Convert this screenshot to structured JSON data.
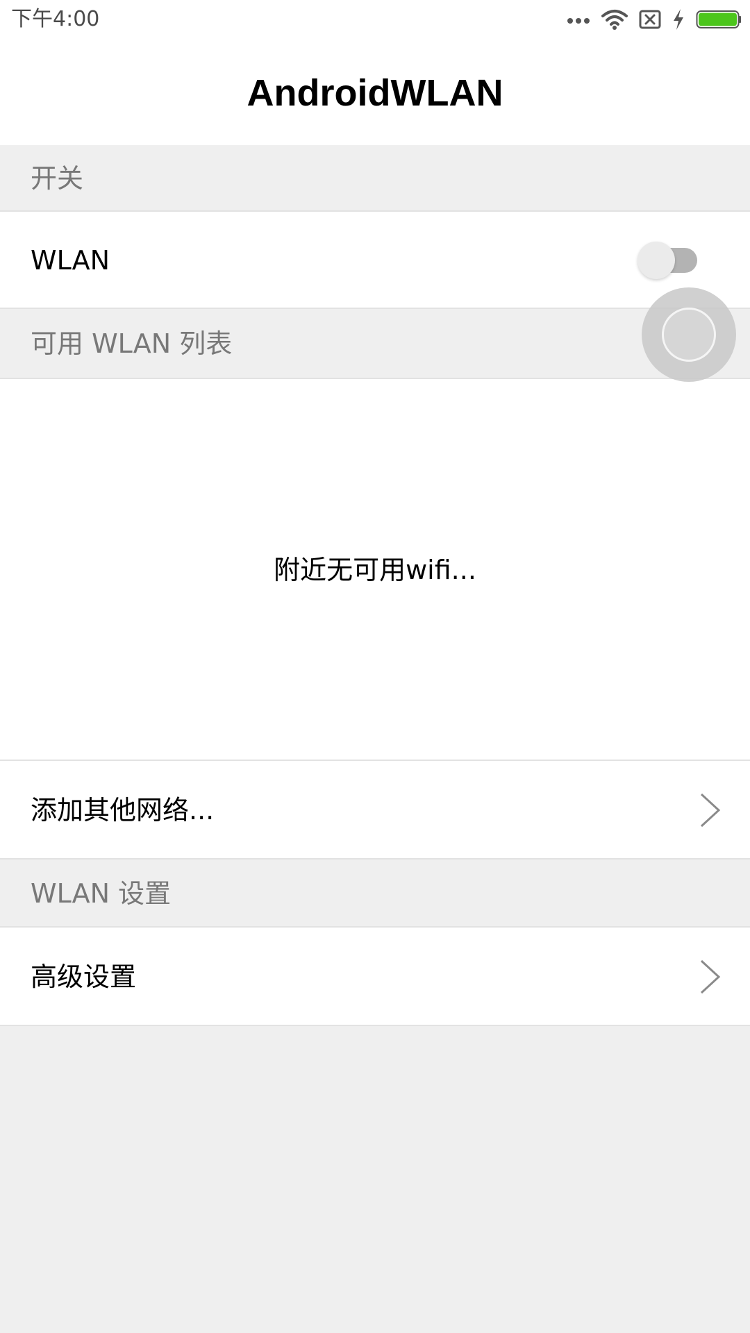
{
  "status_bar": {
    "time": "下午4:00",
    "icons": [
      "more-dots-icon",
      "wifi-icon",
      "sim-error-icon",
      "charging-bolt-icon",
      "battery-icon"
    ],
    "battery_color": "#4cc61c"
  },
  "header": {
    "title": "AndroidWLAN"
  },
  "sections": {
    "switch_header": "开关",
    "available_header": "可用 WLAN 列表",
    "settings_header": "WLAN 设置"
  },
  "wlan_row": {
    "label": "WLAN",
    "toggle_on": false
  },
  "networks": {
    "empty_message": "附近无可用wifi..."
  },
  "add_network_row": {
    "label": "添加其他网络..."
  },
  "advanced_row": {
    "label": "高级设置"
  }
}
